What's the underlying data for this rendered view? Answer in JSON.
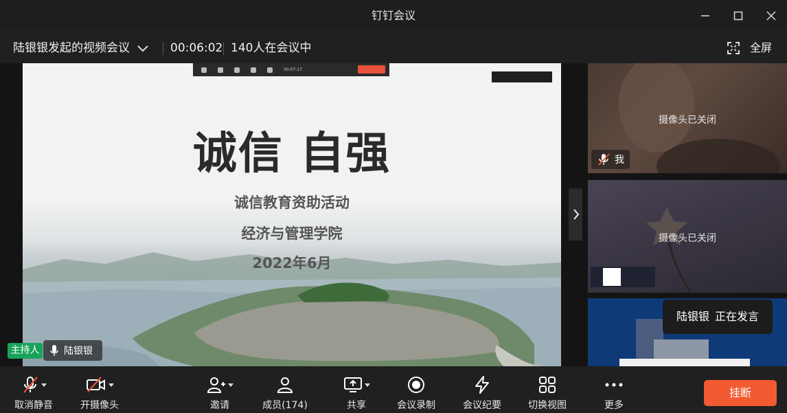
{
  "window": {
    "title": "钉钉会议"
  },
  "infobar": {
    "meeting_name": "陆银银发起的视频会议",
    "duration": "00:06:02",
    "participants_in_meeting": "140人在会议中",
    "fullscreen_label": "全屏"
  },
  "slide": {
    "title": "诚信 自强",
    "line1": "诚信教育资助活动",
    "line2": "经济与管理学院",
    "line3": "2022年6月",
    "mini_toolbar_time": "00:07:17"
  },
  "stage_overlay": {
    "host_badge": "主持人",
    "speaker_name": "陆银银"
  },
  "panel": {
    "tile1_status": "摄像头已关闭",
    "tile1_name": "我",
    "tile2_status": "摄像头已关闭",
    "speaking_name": "陆银银",
    "speaking_status": "正在发言"
  },
  "toolbar": {
    "unmute": "取消静音",
    "camera_on": "开摄像头",
    "invite": "邀请",
    "members": "成员(174)",
    "share": "共享",
    "record": "会议录制",
    "minutes": "会议纪要",
    "switch_view": "切换视图",
    "more": "更多",
    "hangup": "挂断"
  },
  "colors": {
    "accent_red": "#f25a32",
    "host_green": "#19a35a",
    "mute_red": "#e8503a",
    "tile3_blue": "#0f3a78"
  }
}
